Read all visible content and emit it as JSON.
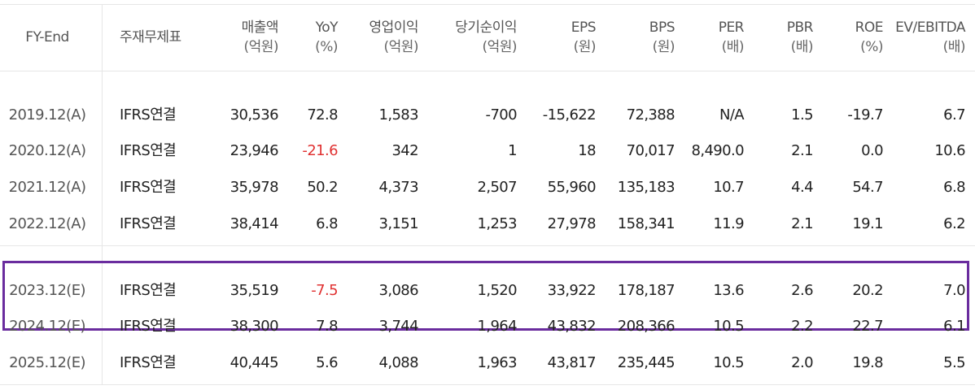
{
  "columns": [
    {
      "label": "FY-End",
      "unit": ""
    },
    {
      "label": "주재무제표",
      "unit": ""
    },
    {
      "label": "매출액",
      "unit": "(억원)"
    },
    {
      "label": "YoY",
      "unit": "(%)"
    },
    {
      "label": "영업이익",
      "unit": "(억원)"
    },
    {
      "label": "당기순이익",
      "unit": "(억원)"
    },
    {
      "label": "EPS",
      "unit": "(원)"
    },
    {
      "label": "BPS",
      "unit": "(원)"
    },
    {
      "label": "PER",
      "unit": "(배)"
    },
    {
      "label": "PBR",
      "unit": "(배)"
    },
    {
      "label": "ROE",
      "unit": "(%)"
    },
    {
      "label": "EV/EBITDA",
      "unit": "(배)"
    }
  ],
  "rows": [
    [
      "2019.12(A)",
      "IFRS연결",
      "30,536",
      "72.8",
      "1,583",
      "-700",
      "-15,622",
      "72,388",
      "N/A",
      "1.5",
      "-19.7",
      "6.7"
    ],
    [
      "2020.12(A)",
      "IFRS연결",
      "23,946",
      "-21.6",
      "342",
      "1",
      "18",
      "70,017",
      "8,490.0",
      "2.1",
      "0.0",
      "10.6"
    ],
    [
      "2021.12(A)",
      "IFRS연결",
      "35,978",
      "50.2",
      "4,373",
      "2,507",
      "55,960",
      "135,183",
      "10.7",
      "4.4",
      "54.7",
      "6.8"
    ],
    [
      "2022.12(A)",
      "IFRS연결",
      "38,414",
      "6.8",
      "3,151",
      "1,253",
      "27,978",
      "158,341",
      "11.9",
      "2.1",
      "19.1",
      "6.2"
    ],
    [
      "2023.12(E)",
      "IFRS연결",
      "35,519",
      "-7.5",
      "3,086",
      "1,520",
      "33,922",
      "178,187",
      "13.6",
      "2.6",
      "20.2",
      "7.0"
    ],
    [
      "2024.12(E)",
      "IFRS연결",
      "38,300",
      "7.8",
      "3,744",
      "1,964",
      "43,832",
      "208,366",
      "10.5",
      "2.2",
      "22.7",
      "6.1"
    ],
    [
      "2025.12(E)",
      "IFRS연결",
      "40,445",
      "5.6",
      "4,088",
      "1,963",
      "43,817",
      "235,445",
      "10.5",
      "2.0",
      "19.8",
      "5.5"
    ]
  ],
  "negative_highlight_color": "#e03131",
  "highlight_box_color": "#6a2c9e",
  "highlighted_rows": [
    "2023.12(E)",
    "2024.12(E)"
  ]
}
